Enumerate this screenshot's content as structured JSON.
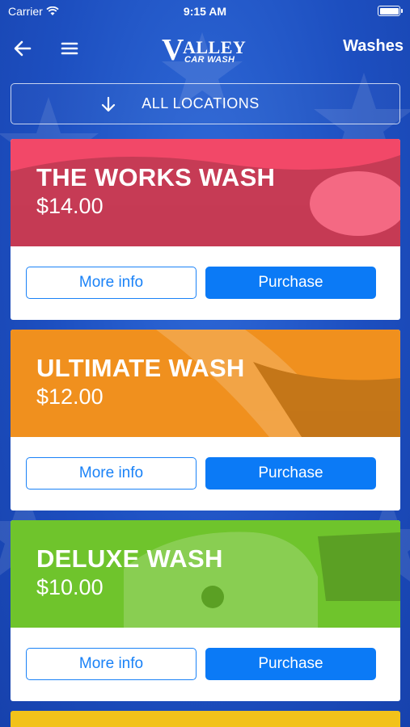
{
  "status_bar": {
    "carrier": "Carrier",
    "time": "9:15 AM"
  },
  "nav": {
    "back_icon": "arrow-left-icon",
    "menu_icon": "hamburger-menu-icon",
    "logo": {
      "brand": "VALLEY",
      "sub": "CAR WASH"
    },
    "title": "Washes"
  },
  "locations": {
    "label": "ALL LOCATIONS",
    "icon": "arrow-down-icon"
  },
  "washes": [
    {
      "name": "THE WORKS WASH",
      "price": "$14.00",
      "color": "#f24868",
      "more_label": "More info",
      "purchase_label": "Purchase"
    },
    {
      "name": "ULTIMATE WASH",
      "price": "$12.00",
      "color": "#f0901e",
      "more_label": "More info",
      "purchase_label": "Purchase"
    },
    {
      "name": "DELUXE WASH",
      "price": "$10.00",
      "color": "#6fc42c",
      "more_label": "More info",
      "purchase_label": "Purchase"
    }
  ],
  "next_card_color": "#f2c21a",
  "colors": {
    "accent": "#0b7af6",
    "background": "#1f55c4"
  }
}
